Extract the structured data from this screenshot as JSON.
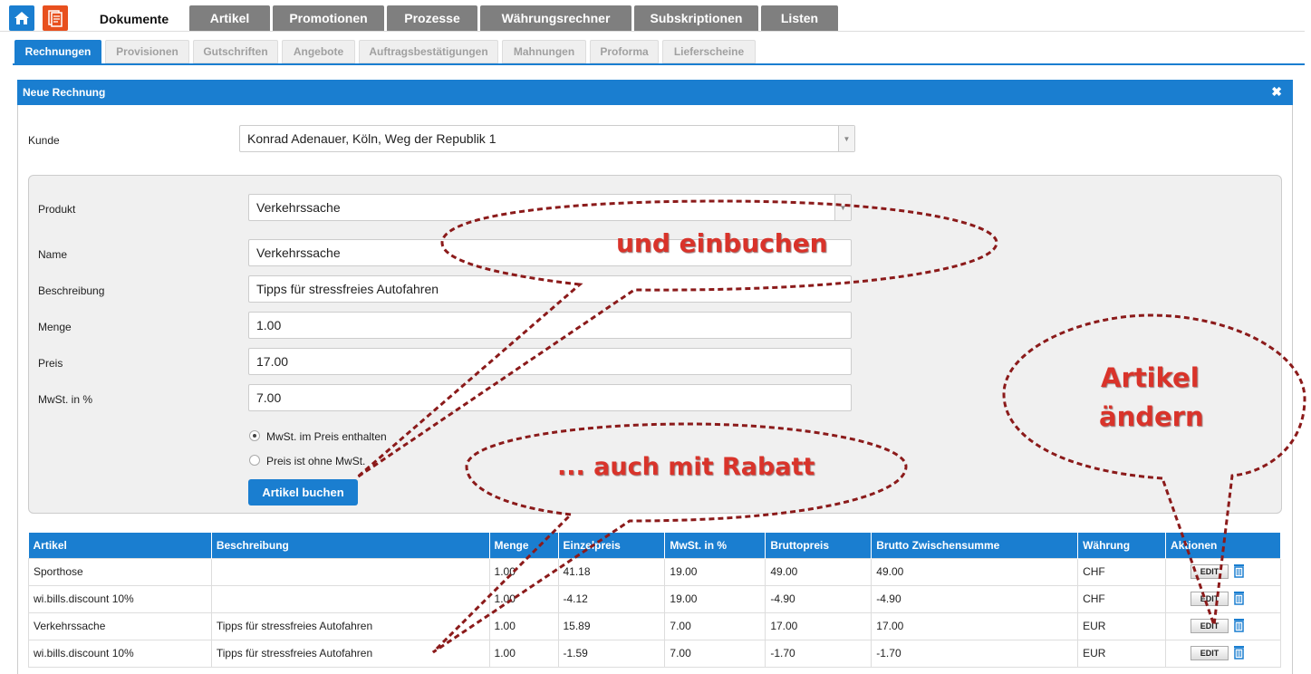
{
  "nav": {
    "tabs": [
      "Dokumente",
      "Artikel",
      "Promotionen",
      "Prozesse",
      "Währungsrechner",
      "Subskriptionen",
      "Listen"
    ],
    "active_tab": "Dokumente"
  },
  "subnav": {
    "items": [
      "Rechnungen",
      "Provisionen",
      "Gutschriften",
      "Angebote",
      "Auftragsbestätigungen",
      "Mahnungen",
      "Proforma",
      "Lieferscheine"
    ],
    "active": "Rechnungen"
  },
  "panel": {
    "title": "Neue Rechnung",
    "kunde_label": "Kunde",
    "kunde_value": "Konrad Adenauer, Köln, Weg der Republik 1"
  },
  "form": {
    "produkt_label": "Produkt",
    "produkt_value": "Verkehrssache",
    "name_label": "Name",
    "name_value": "Verkehrssache",
    "beschreibung_label": "Beschreibung",
    "beschreibung_value": "Tipps für stressfreies Autofahren",
    "menge_label": "Menge",
    "menge_value": "1.00",
    "preis_label": "Preis",
    "preis_value": "17.00",
    "mwst_label": "MwSt. in %",
    "mwst_value": "7.00",
    "radio_incl": "MwSt. im Preis enthalten",
    "radio_excl": "Preis ist ohne MwSt.",
    "book_button": "Artikel buchen"
  },
  "table": {
    "headers": [
      "Artikel",
      "Beschreibung",
      "Menge",
      "Einzelpreis",
      "MwSt. in %",
      "Bruttopreis",
      "Brutto Zwischensumme",
      "Währung",
      "Aktionen"
    ],
    "rows": [
      [
        "Sporthose",
        "",
        "1.00",
        "41.18",
        "19.00",
        "49.00",
        "49.00",
        "CHF"
      ],
      [
        "wi.bills.discount 10%",
        "",
        "1.00",
        "-4.12",
        "19.00",
        "-4.90",
        "-4.90",
        "CHF"
      ],
      [
        "Verkehrssache",
        "Tipps für stressfreies Autofahren",
        "1.00",
        "15.89",
        "7.00",
        "17.00",
        "17.00",
        "EUR"
      ],
      [
        "wi.bills.discount 10%",
        "Tipps für stressfreies Autofahren",
        "1.00",
        "-1.59",
        "7.00",
        "-1.70",
        "-1.70",
        "EUR"
      ]
    ],
    "edit_label": "EDIT"
  },
  "annotations": {
    "bubble1": "und einbuchen",
    "bubble2": "... auch mit Rabatt",
    "bubble3_line1": "Artikel",
    "bubble3_line2": "ändern"
  },
  "colors": {
    "accent": "#1a7ed0",
    "tab_inactive": "#7f7f7f",
    "annotation_red": "#d9332a",
    "annotation_line": "#8b1a1a",
    "docs_icon_bg": "#e8501e"
  },
  "icons": [
    "home-icon",
    "documents-icon",
    "close-icon",
    "dropdown-arrow-icon",
    "trash-icon"
  ]
}
